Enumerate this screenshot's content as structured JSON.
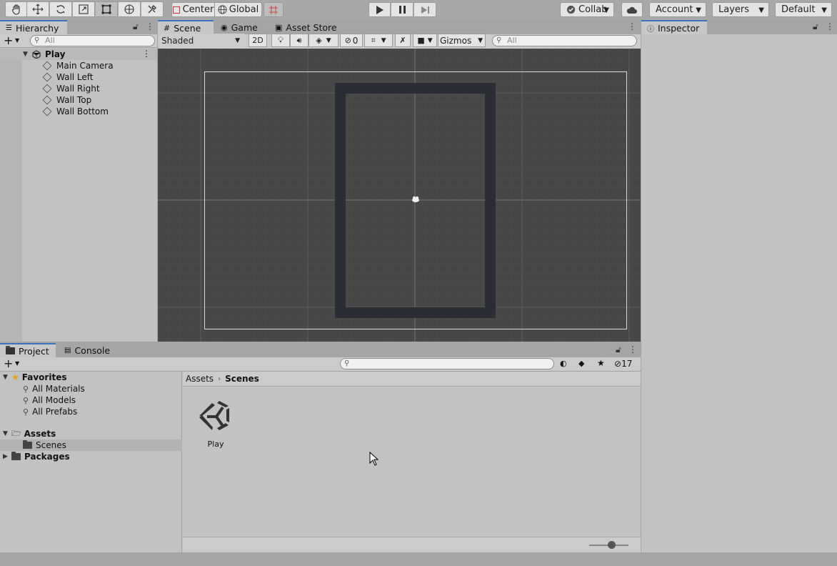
{
  "toolbar": {
    "tools": [
      "hand-icon",
      "move-icon",
      "rotate-icon",
      "scale-icon",
      "rect-icon",
      "transform-icon",
      "custom-tool-icon"
    ],
    "center_label": "Center",
    "global_label": "Global",
    "collab_label": "Collab",
    "account_label": "Account",
    "layers_label": "Layers",
    "layout_label": "Default"
  },
  "hierarchy": {
    "tab_label": "Hierarchy",
    "search_placeholder": "All",
    "scene_name": "Play",
    "items": [
      "Main Camera",
      "Wall Left",
      "Wall Right",
      "Wall Top",
      "Wall Bottom"
    ]
  },
  "scene": {
    "tabs": [
      "Scene",
      "Game",
      "Asset Store"
    ],
    "shading_label": "Shaded",
    "mode_2d_label": "2D",
    "hidden_count": "0",
    "gizmos_label": "Gizmos",
    "search_placeholder": "All"
  },
  "inspector": {
    "tab_label": "Inspector"
  },
  "project": {
    "tabs": [
      "Project",
      "Console"
    ],
    "hidden_count": "17",
    "favorites_label": "Favorites",
    "favorites": [
      "All Materials",
      "All Models",
      "All Prefabs"
    ],
    "assets_label": "Assets",
    "scenes_label": "Scenes",
    "packages_label": "Packages",
    "breadcrumb": [
      "Assets",
      "Scenes"
    ],
    "asset_items": [
      "Play"
    ]
  },
  "colors": {
    "accent": "#3a72c4",
    "panel_bg": "#c2c2c2",
    "scene_bg": "#474747",
    "wall": "#2b2d34",
    "selection": "#b2b2b2"
  }
}
